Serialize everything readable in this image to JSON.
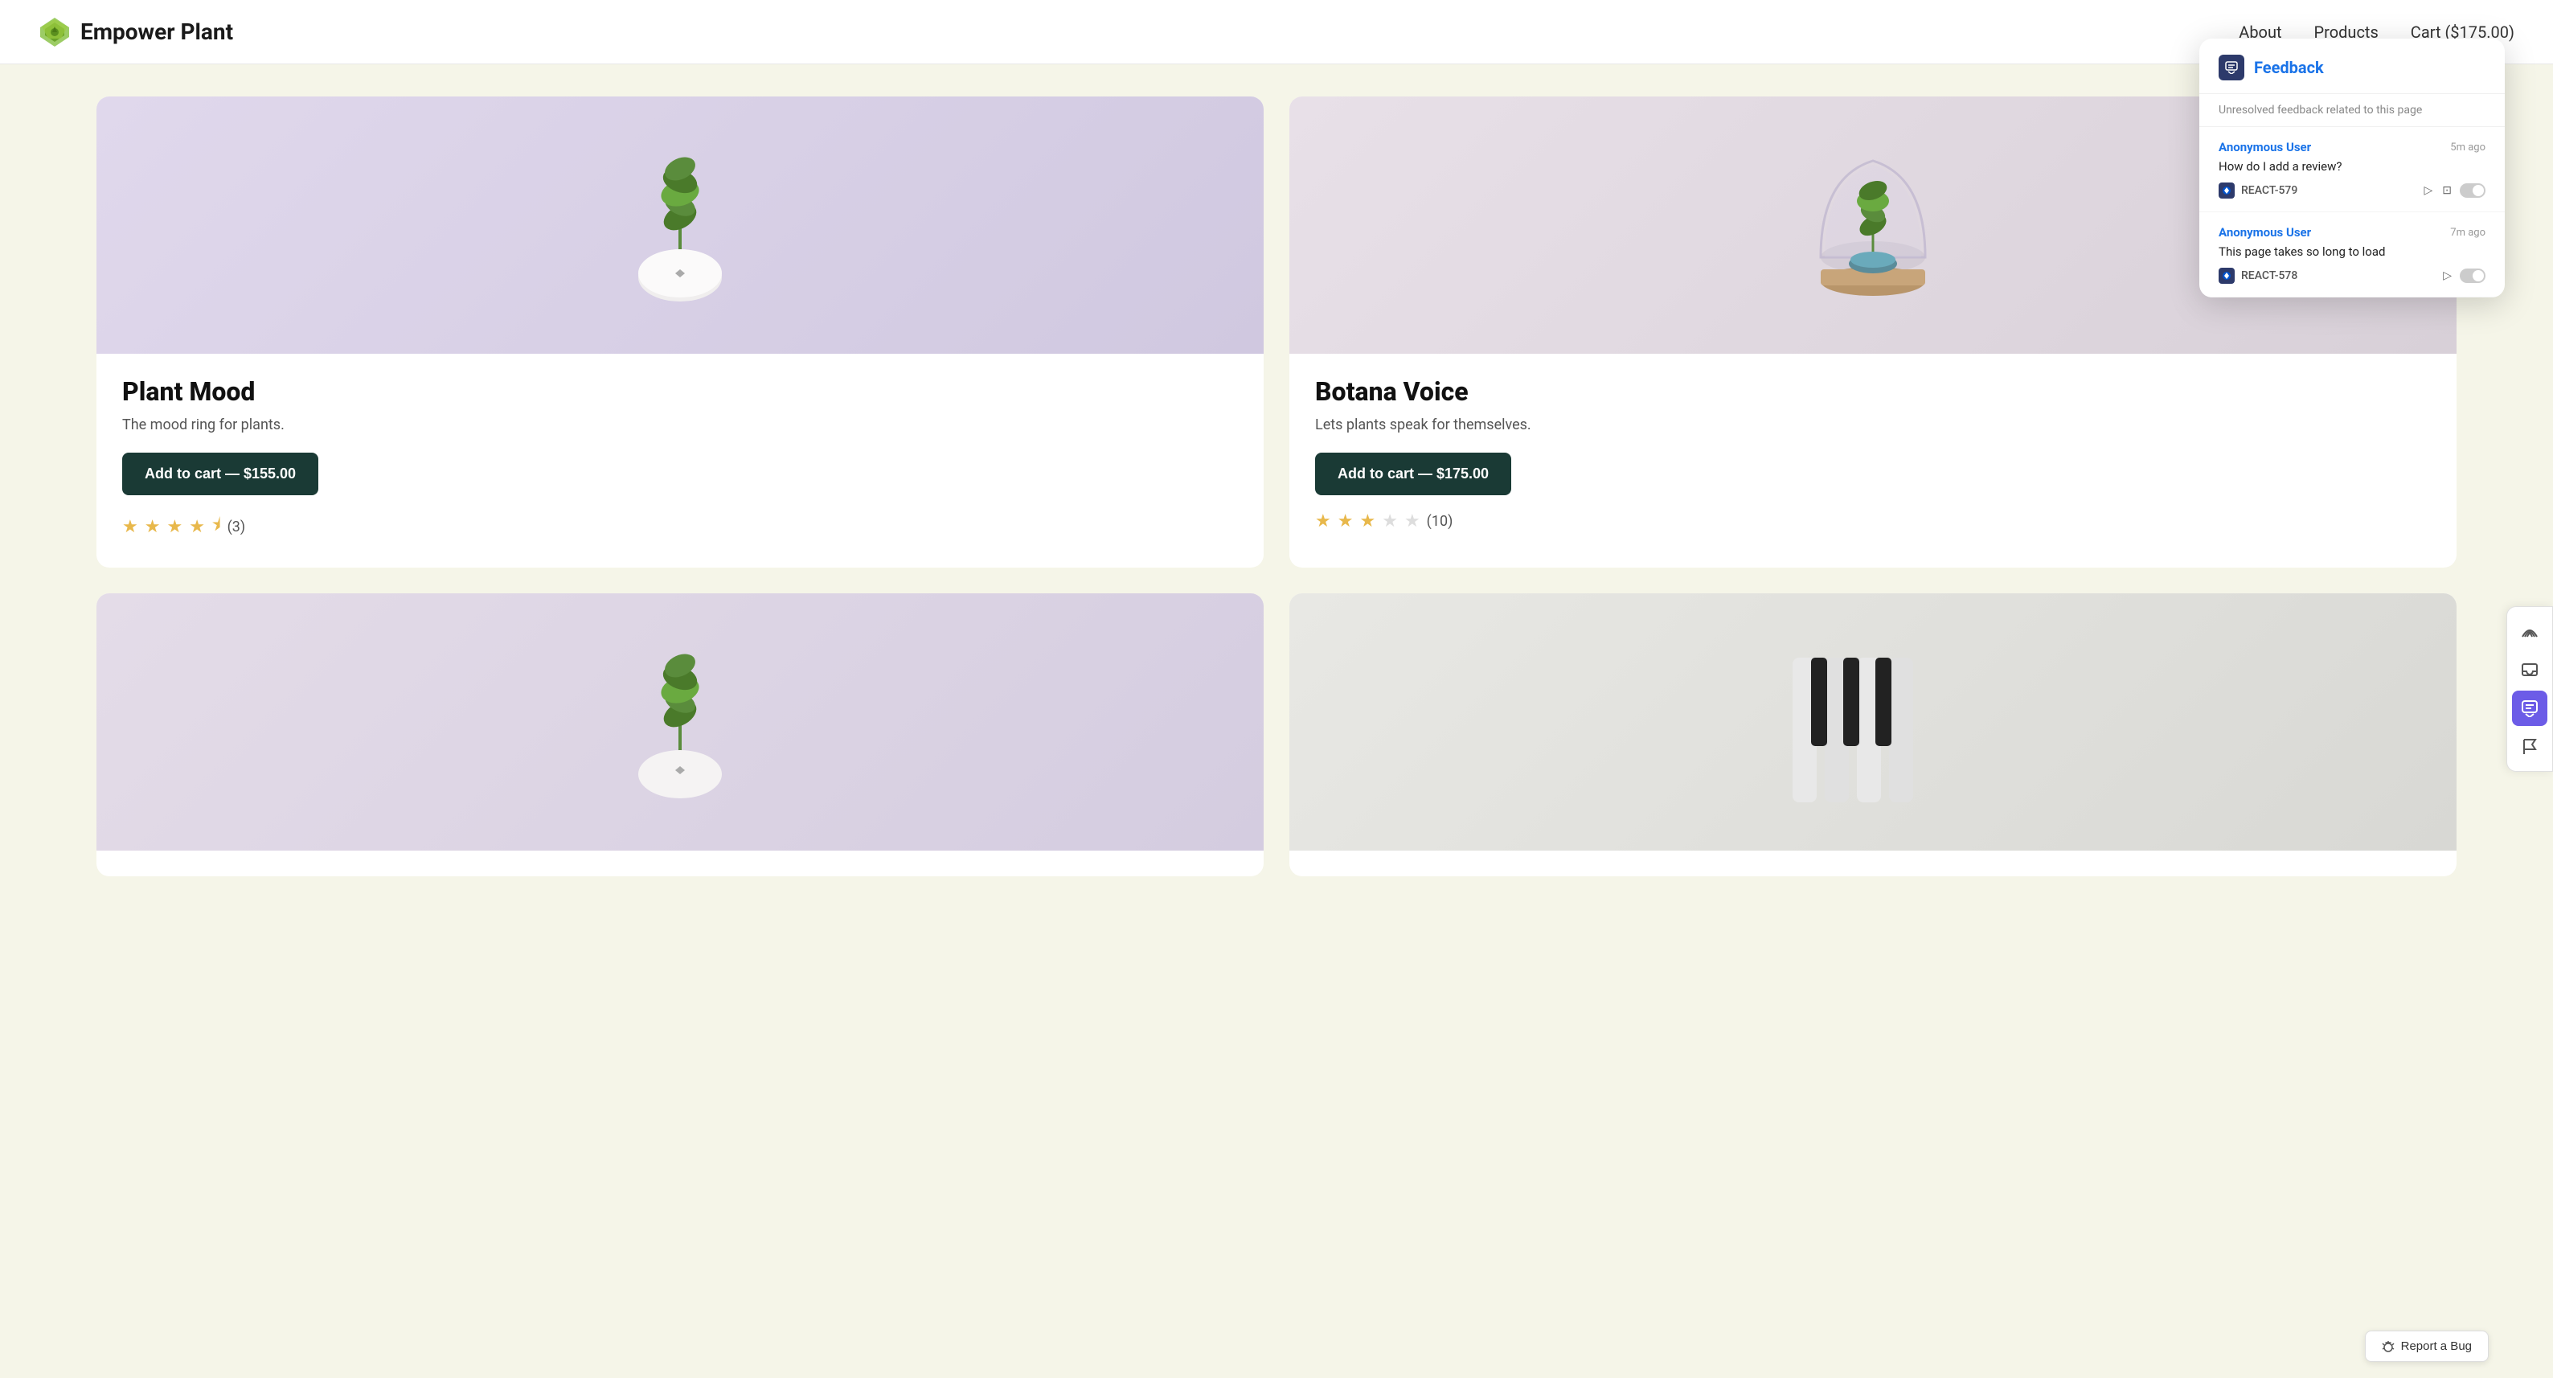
{
  "header": {
    "logo_text": "Empower Plant",
    "nav": {
      "about": "About",
      "products": "Products",
      "cart": "Cart ($175.00)"
    }
  },
  "products": [
    {
      "id": "plant-mood",
      "name": "Plant Mood",
      "description": "The mood ring for plants.",
      "button_label": "Add to cart — $155.00",
      "price": "$155.00",
      "rating": 4.5,
      "rating_count": "(3)",
      "stars": [
        "filled",
        "filled",
        "filled",
        "filled",
        "half"
      ],
      "image_type": "plant-mood"
    },
    {
      "id": "botana-voice",
      "name": "Botana Voice",
      "description": "Lets plants speak for themselves.",
      "button_label": "Add to cart — $175.00",
      "price": "$175.00",
      "rating": 3.0,
      "rating_count": "(10)",
      "stars": [
        "filled",
        "filled",
        "filled",
        "empty",
        "empty"
      ],
      "image_type": "botana-voice"
    },
    {
      "id": "product-3",
      "name": "",
      "description": "",
      "button_label": "",
      "price": "",
      "rating_count": "",
      "stars": [],
      "image_type": "bottom-left"
    },
    {
      "id": "product-4",
      "name": "",
      "description": "",
      "button_label": "",
      "price": "",
      "rating_count": "",
      "stars": [],
      "image_type": "bottom-right"
    }
  ],
  "feedback_panel": {
    "title": "Feedback",
    "subtitle": "Unresolved feedback related to this page",
    "items": [
      {
        "user": "Anonymous User",
        "time": "5m ago",
        "message": "How do I add a review?",
        "ticket_id": "REACT-579",
        "has_image": true
      },
      {
        "user": "Anonymous User",
        "time": "7m ago",
        "message": "This page takes so long to load",
        "ticket_id": "REACT-578",
        "has_image": false
      }
    ]
  },
  "sidebar_toolbar": {
    "buttons": [
      {
        "icon": "signal",
        "name": "signal-icon",
        "active": false
      },
      {
        "icon": "inbox",
        "name": "inbox-icon",
        "active": false
      },
      {
        "icon": "feedback",
        "name": "feedback-icon",
        "active": true
      },
      {
        "icon": "flag",
        "name": "flag-icon",
        "active": false
      }
    ]
  },
  "report_bug": {
    "label": "Report a Bug"
  }
}
